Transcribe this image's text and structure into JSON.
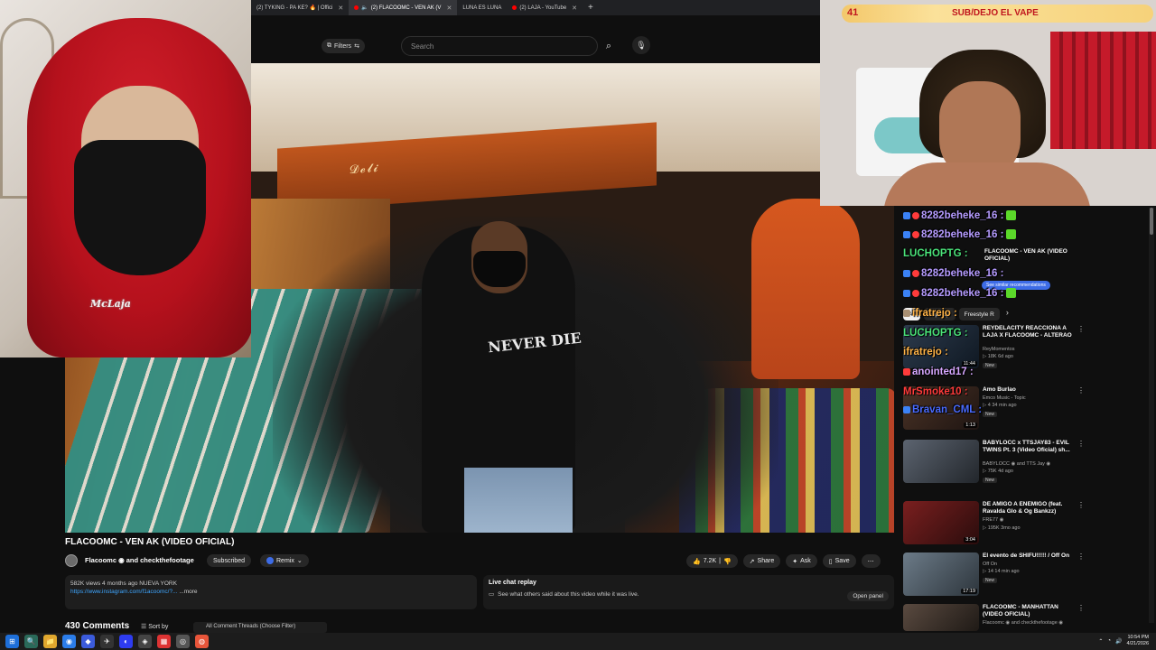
{
  "browser": {
    "tabs": [
      {
        "label": "(2) TYKING - PA KE? 🔥 | Offici",
        "active": false
      },
      {
        "label": "(2) FLACOOMC - VEN AK (V",
        "active": true
      },
      {
        "label": "LUNA ES LUNA",
        "active": false
      },
      {
        "label": "(2) LAJA - YouTube",
        "active": false
      }
    ],
    "new_tab": "+"
  },
  "youtube": {
    "filters_label": "Filters",
    "search_placeholder": "Search",
    "video": {
      "sign_text": "𝓓𝓮𝓵𝓲",
      "shirt_text": "NEVER DIE"
    },
    "title": "FLACOOMC - VEN AK (VIDEO OFICIAL)",
    "channel": "Flacoomc ◉ and checkthefootage",
    "subscribed_label": "Subscribed",
    "remix_label": "Remix",
    "actions": {
      "like": "7.2K",
      "share": "Share",
      "ask": "Ask",
      "save": "Save"
    },
    "description": {
      "meta": "582K views  4 months ago  NUEVA YORK",
      "link": "https://www.instagram.com/f1acoomc/?...",
      "more": "...more"
    },
    "live_chat": {
      "title": "Live chat replay",
      "subtitle": "See what others said about this video while it was live.",
      "open_panel": "Open panel"
    },
    "comments": {
      "count_label": "430 Comments",
      "sort_label": "Sort by",
      "thread_select": "All Comment Threads (Choose Filter)"
    },
    "chips": [
      "All",
      "Hip hop",
      "Freestyle R"
    ],
    "recommendations": [
      {
        "title": "FLACOOMC - VEN AK (VIDEO OFICIAL)",
        "channel": "",
        "meta": "",
        "duration": "",
        "new": "",
        "thumb": "#7a3a2a"
      },
      {
        "title": "REYDELACITY REACCIONA A LAJA X FLACOOMC - ALTERAO",
        "channel": "ReyMomentos",
        "meta": "▷ 18K  6d ago",
        "duration": "11:44",
        "new": "New",
        "thumb": "#1d2a3a"
      },
      {
        "title": "Amo Burlao",
        "channel": "Emco Music - Topic",
        "meta": "▷ 4  34 min ago",
        "duration": "1:13",
        "new": "New",
        "thumb": "#3a2a22"
      },
      {
        "title": "BABYLOCC x TTSJAY83 - EVIL TWINS Pt. 3 (Video Oficial) sh...",
        "channel": "BABYLOCC ◉ and TTS Jay ◉",
        "meta": "▷ 75K  4d ago",
        "duration": "",
        "new": "New",
        "thumb": "#3b3f46"
      },
      {
        "title": "DE AMIGO A ENEMIGO (feat. Ravalda Glo & Og Bankzz)",
        "channel": "FRE77 ◉",
        "meta": "▷ 195K  3mo ago",
        "duration": "3:04",
        "new": "",
        "thumb": "#5a1a1a"
      },
      {
        "title": "El evento de SHIFU!!!!! / Off On",
        "channel": "Off On",
        "meta": "▷ 14  14 min ago",
        "duration": "17:19",
        "new": "New",
        "thumb": "#4a5560"
      },
      {
        "title": "FLACOOMC - MANHATTAN (VIDEO OFICIAL)",
        "channel": "Flacoomc ◉ and checkthefootage ◉",
        "meta": "",
        "duration": "",
        "new": "",
        "thumb": "#3a2f28"
      }
    ],
    "similar_label": "See similar recommendations"
  },
  "stream_chat": [
    {
      "user": "8282beheke_16 :",
      "color": "#9b7bff"
    },
    {
      "user": "8282beheke_16 :",
      "color": "#9b7bff"
    },
    {
      "user": "LUCHOPTG :",
      "color": "#4be37a"
    },
    {
      "user": "8282beheke_16 :",
      "color": "#9b7bff"
    },
    {
      "user": "8282beheke_16 :",
      "color": "#9b7bff"
    },
    {
      "user": "ifratrejo :",
      "color": "#ffb347"
    },
    {
      "user": "LUCHOPTG :",
      "color": "#4be37a"
    },
    {
      "user": "ifratrejo :",
      "color": "#ffb347"
    },
    {
      "user": "anointed17 :",
      "color": "#c68cff"
    },
    {
      "user": "MrSmoke10 :",
      "color": "#ff3b3b"
    },
    {
      "user": "Bravan_CML :",
      "color": "#3b5bff"
    }
  ],
  "webcam_left": {
    "chain_text": "McLaja"
  },
  "webcam_right": {
    "goal_count": "41",
    "banner_text": "SUB/DEJO EL VAPE"
  },
  "taskbar": {
    "time": "10:54 PM",
    "date": "4/21/2026",
    "apps": [
      "⊞",
      "🔍",
      "▣",
      "📁",
      "◉",
      "◆",
      "✈",
      "◐",
      "◈",
      "▦",
      "◎",
      "◍",
      "◉"
    ]
  }
}
